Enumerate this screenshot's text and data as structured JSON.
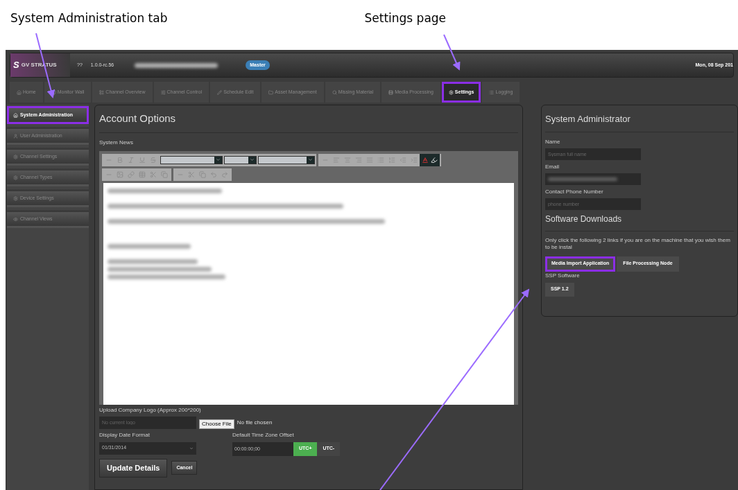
{
  "annotations": [
    {
      "text": "System Administration tab"
    },
    {
      "text": "Settings page"
    }
  ],
  "header": {
    "logo_mark": "S",
    "logo": "GV STRATUS",
    "help": "??",
    "version": "1.0.0-rc.56",
    "role": "Master",
    "date": "Mon, 08 Sep 201"
  },
  "tabs": [
    {
      "label": "Home",
      "selected": false,
      "highlighted": false
    },
    {
      "label": "Monitor Wall",
      "selected": false,
      "highlighted": false
    },
    {
      "label": "Channel Overview",
      "selected": false,
      "highlighted": false
    },
    {
      "label": "Channel Control",
      "selected": false,
      "highlighted": false
    },
    {
      "label": "Schedule Edit",
      "selected": false,
      "highlighted": false
    },
    {
      "label": "Asset Management",
      "selected": false,
      "highlighted": false
    },
    {
      "label": "Missing Material",
      "selected": false,
      "highlighted": false
    },
    {
      "label": "Media Processing",
      "selected": false,
      "highlighted": false
    },
    {
      "label": "Settings",
      "selected": true,
      "highlighted": true
    },
    {
      "label": "Logging",
      "selected": false,
      "highlighted": false
    }
  ],
  "sidebar": {
    "items": [
      {
        "label": "System Administration",
        "selected": true,
        "highlighted": true
      },
      {
        "label": "User Administration",
        "selected": false,
        "highlighted": false
      },
      {
        "label": "Channel Settings",
        "selected": false,
        "highlighted": false
      },
      {
        "label": "Channel Types",
        "selected": false,
        "highlighted": false
      },
      {
        "label": "Device Settings",
        "selected": false,
        "highlighted": false
      },
      {
        "label": "Channel Views",
        "selected": false,
        "highlighted": false
      }
    ]
  },
  "account": {
    "title": "Account Options",
    "news_label": "System News",
    "logo_label": "Upload Company Logo (Approx 200*200)",
    "logo_placeholder": "No current logo",
    "choose_file": "Choose File",
    "no_file": "No file chosen",
    "date_format_label": "Display Date Format",
    "date_format": "01/31/2014",
    "tz_label": "Default Time Zone Offset",
    "tz_value": "00:00:00;00",
    "tz_buttons": [
      {
        "label": "UTC+",
        "selected": true
      },
      {
        "label": "UTC-",
        "selected": false
      }
    ],
    "buttons": [
      "Update Details",
      "Cancel"
    ]
  },
  "admin": {
    "title": "System Administrator",
    "fields": [
      {
        "label": "Name",
        "kind": "placeholder",
        "placeholder": "Sysman full name"
      },
      {
        "label": "Email",
        "kind": "blurred"
      },
      {
        "label": "Contact Phone Number",
        "kind": "placeholder",
        "placeholder": "phone number"
      }
    ],
    "downloads_title": "Software Downloads",
    "note": "Only click the following 2 links if you are on the machine that you wish them to be instal",
    "download_buttons": [
      {
        "label": "Media Import Application",
        "highlighted": true
      },
      {
        "label": "File Processing Node",
        "highlighted": false
      }
    ],
    "ssp_label": "SSP Software",
    "ssp_button": "SSP 1.2"
  }
}
